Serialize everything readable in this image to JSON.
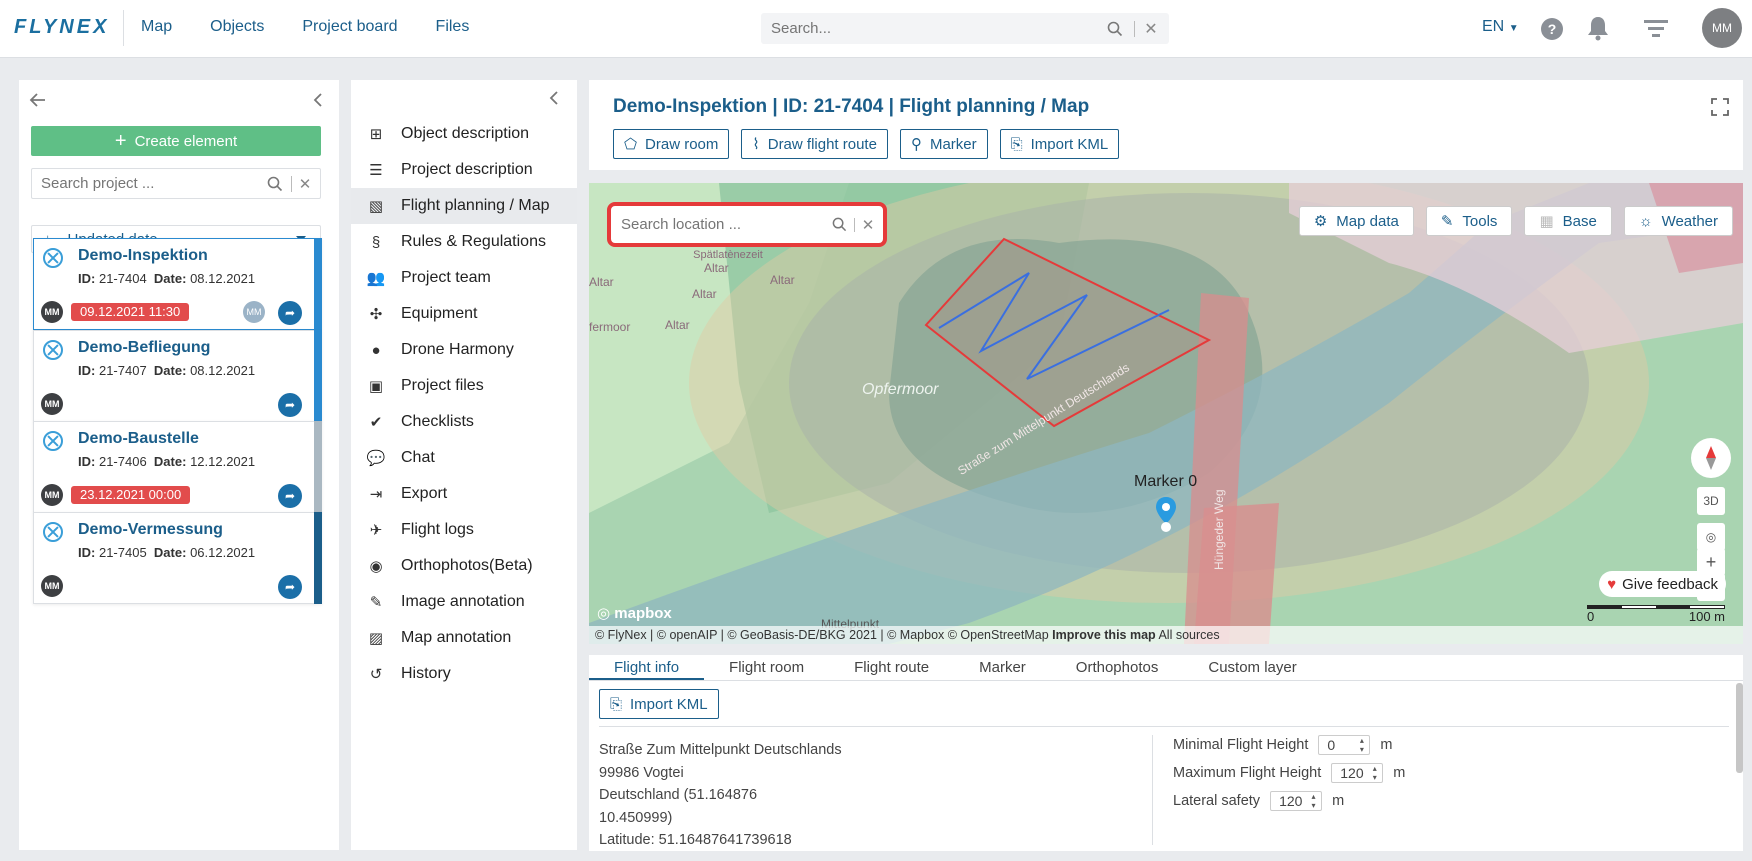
{
  "app": {
    "logo": "FLYNEX",
    "avatar_initials": "MM"
  },
  "topnav": {
    "items": [
      "Map",
      "Objects",
      "Project board",
      "Files"
    ]
  },
  "search": {
    "placeholder": "Search..."
  },
  "lang": "EN",
  "help": "?",
  "left": {
    "create_label": "Create element",
    "search_placeholder": "Search project ...",
    "sort_label": "Updated date",
    "cards": [
      {
        "name": "Demo-Inspektion",
        "id": "21-7404",
        "date": "08.12.2021",
        "badge": "09.12.2021 11:30",
        "owner": "MM",
        "assignee": "MM",
        "stripe": "#2a8ad0"
      },
      {
        "name": "Demo-Befliegung",
        "id": "21-7407",
        "date": "08.12.2021",
        "badge": "",
        "owner": "MM",
        "assignee": "",
        "stripe": "#2a8ad0"
      },
      {
        "name": "Demo-Baustelle",
        "id": "21-7406",
        "date": "12.12.2021",
        "badge": "23.12.2021 00:00",
        "owner": "MM",
        "assignee": "",
        "stripe": "#aab8c2"
      },
      {
        "name": "Demo-Vermessung",
        "id": "21-7405",
        "date": "06.12.2021",
        "badge": "",
        "owner": "MM",
        "assignee": "",
        "stripe": "#1b5e8a"
      }
    ],
    "id_label": "ID:",
    "date_label": "Date:"
  },
  "menu": {
    "items": [
      {
        "label": "Object description",
        "icon": "hierarchy-icon",
        "glyph": "⊞"
      },
      {
        "label": "Project description",
        "icon": "list-icon",
        "glyph": "☰"
      },
      {
        "label": "Flight planning / Map",
        "icon": "map-icon",
        "glyph": "▧"
      },
      {
        "label": "Rules & Regulations",
        "icon": "section-icon",
        "glyph": "§"
      },
      {
        "label": "Project team",
        "icon": "team-icon",
        "glyph": "👥"
      },
      {
        "label": "Equipment",
        "icon": "drone-icon",
        "glyph": "✣"
      },
      {
        "label": "Drone Harmony",
        "icon": "circle-icon",
        "glyph": "●"
      },
      {
        "label": "Project files",
        "icon": "image-icon",
        "glyph": "▣"
      },
      {
        "label": "Checklists",
        "icon": "clipboard-icon",
        "glyph": "✔"
      },
      {
        "label": "Chat",
        "icon": "chat-icon",
        "glyph": "💬"
      },
      {
        "label": "Export",
        "icon": "export-icon",
        "glyph": "⇥"
      },
      {
        "label": "Flight logs",
        "icon": "plane-icon",
        "glyph": "✈"
      },
      {
        "label": "Orthophotos(Beta)",
        "icon": "camera-icon",
        "glyph": "◉"
      },
      {
        "label": "Image annotation",
        "icon": "edit-image-icon",
        "glyph": "✎"
      },
      {
        "label": "Map annotation",
        "icon": "map-edit-icon",
        "glyph": "▨"
      },
      {
        "label": "History",
        "icon": "history-icon",
        "glyph": "↺"
      }
    ],
    "active": 2
  },
  "main": {
    "title": "Demo-Inspektion | ID: 21-7404 | Flight planning / Map",
    "toolbar": [
      "Draw room",
      "Draw flight route",
      "Marker",
      "Import KML"
    ]
  },
  "map": {
    "search_placeholder": "Search location ...",
    "buttons": [
      "Map data",
      "Tools",
      "Base",
      "Weather"
    ],
    "labels": {
      "place": "Opfermoor",
      "road": "Straße zum Mittelpunkt Deutschlands",
      "road2": "Hüngeder Weg",
      "gotter": "Götterbilder der Spätlatènezeit",
      "altar": "Altar",
      "fermoor": "fermoor",
      "mittelpunkt": "Mittelpunkt"
    },
    "marker_label": "Marker 0",
    "feedback": "Give feedback",
    "scale": {
      "left": "0",
      "right": "100 m"
    },
    "ctrl_3d": "3D",
    "mapbox_logo": "mapbox",
    "attribution": "© FlyNex | © openAIP | © GeoBasis-DE/BKG 2021 | © Mapbox © OpenStreetMap",
    "attribution_bold": "Improve this map",
    "attribution_end": "All sources"
  },
  "bottom": {
    "tabs": [
      "Flight info",
      "Flight room",
      "Flight route",
      "Marker",
      "Orthophotos",
      "Custom layer"
    ],
    "active_tab": 0,
    "kml_label": "Import KML",
    "address": [
      "Straße Zum Mittelpunkt Deutschlands",
      "99986 Vogtei",
      "Deutschland (51.164876",
      "10.450999)",
      "Latitude: 51.16487641739618"
    ],
    "fields": [
      {
        "label": "Minimal Flight Height",
        "value": "0",
        "unit": "m"
      },
      {
        "label": "Maximum Flight Height",
        "value": "120",
        "unit": "m"
      },
      {
        "label": "Lateral safety",
        "value": "120",
        "unit": "m"
      }
    ]
  },
  "colors": {
    "brand": "#1b5e8a",
    "create": "#5fbf86",
    "badge": "#e24c4c",
    "search_highlight": "#e53a3a",
    "route": "#3a6fe0"
  }
}
